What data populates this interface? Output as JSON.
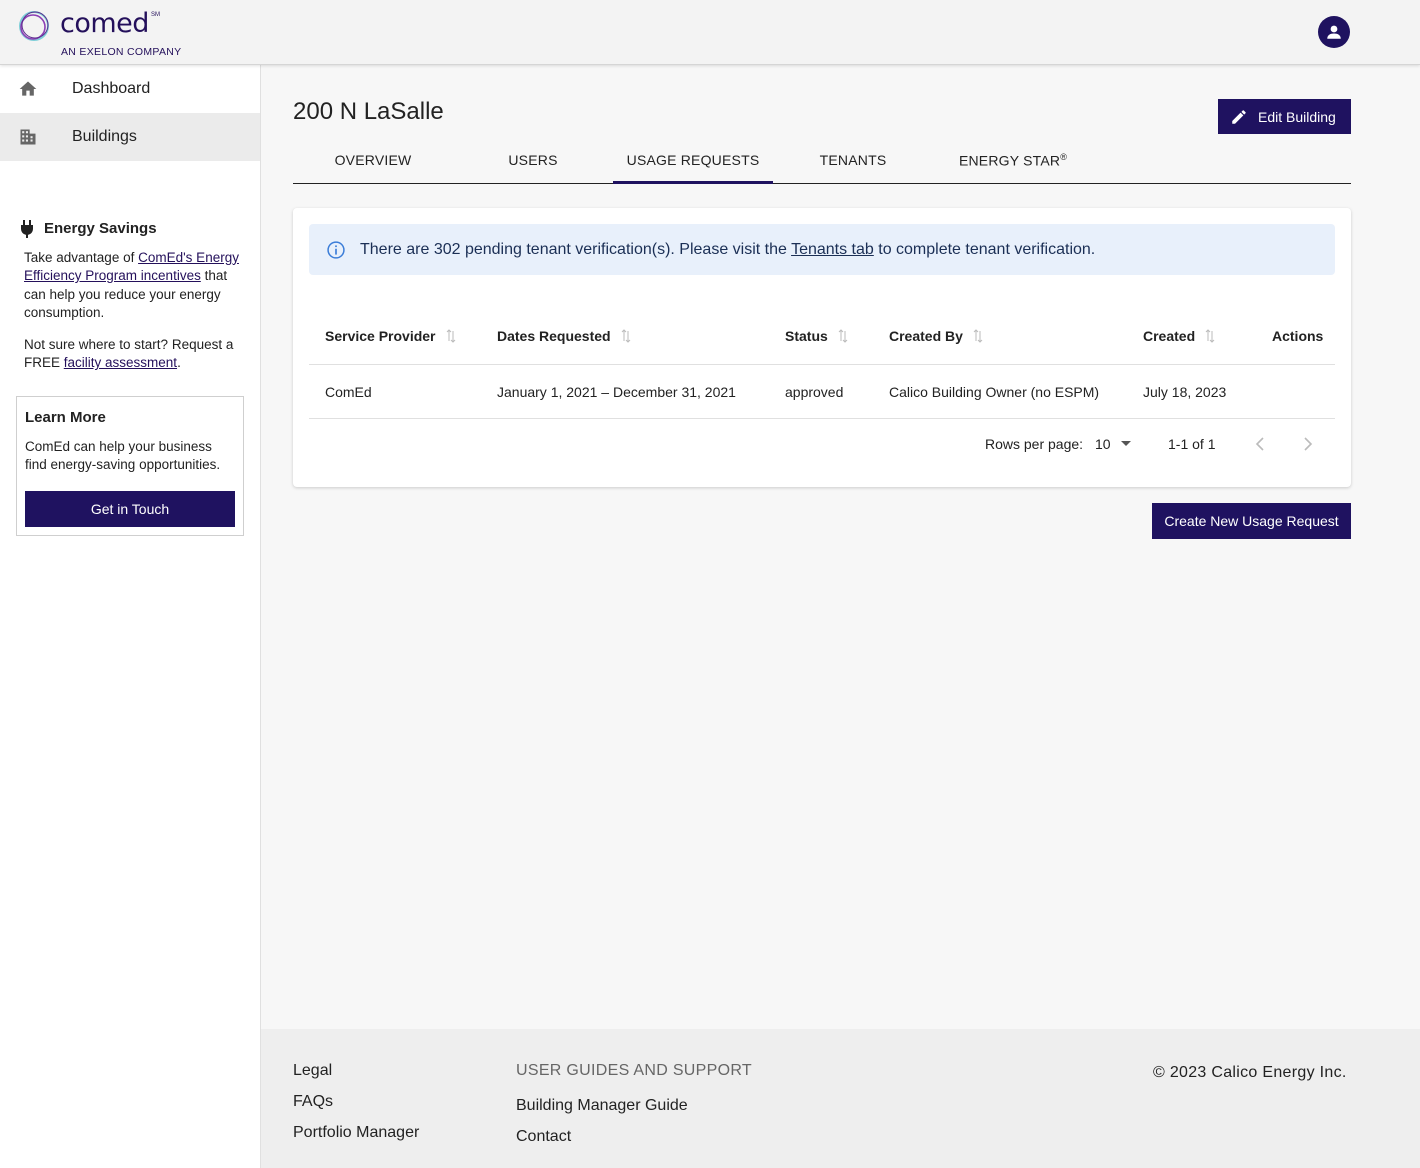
{
  "header": {
    "logo_word": "comed",
    "logo_sm": "SM",
    "logo_sub": "AN EXELON COMPANY"
  },
  "sidebar": {
    "items": [
      {
        "label": "Dashboard",
        "icon": "home-icon"
      },
      {
        "label": "Buildings",
        "icon": "building-icon"
      }
    ],
    "energy": {
      "title": "Energy Savings",
      "p1_before": "Take advantage of ",
      "p1_link": "ComEd's Energy Efficiency Program incentives",
      "p1_after": " that can help you reduce your energy consumption.",
      "p2_before": "Not sure where to start? Request a FREE ",
      "p2_link": "facility assessment",
      "p2_after": "."
    },
    "learn": {
      "title": "Learn More",
      "text": "ComEd can help your business find energy-saving opportunities.",
      "button": "Get in Touch"
    }
  },
  "main": {
    "title": "200 N LaSalle",
    "edit_button": "Edit Building",
    "tabs": [
      "OVERVIEW",
      "USERS",
      "USAGE REQUESTS",
      "TENANTS",
      "ENERGY STAR"
    ],
    "tab_sup": "®",
    "alert": {
      "before": "There are 302 pending tenant verification(s). Please visit the ",
      "link": "Tenants tab",
      "after": " to complete tenant verification."
    },
    "table": {
      "columns": [
        "Service Provider",
        "Dates Requested",
        "Status",
        "Created By",
        "Created",
        "Actions"
      ],
      "rows": [
        [
          "ComEd",
          "January 1, 2021 – December 31, 2021",
          "approved",
          "Calico Building Owner (no ESPM)",
          "July 18, 2023",
          ""
        ]
      ]
    },
    "pagination": {
      "rows_label": "Rows per page:",
      "rows_value": "10",
      "range": "1-1 of 1"
    },
    "create_button": "Create New Usage Request"
  },
  "footer": {
    "links": [
      "Legal",
      "FAQs",
      "Portfolio Manager"
    ],
    "support_heading": "USER GUIDES AND SUPPORT",
    "support_links": [
      "Building Manager Guide",
      "Contact"
    ],
    "copyright": "© 2023 Calico Energy Inc."
  },
  "colors": {
    "brand": "#1f1260",
    "alert_bg": "#e8f0fb"
  }
}
